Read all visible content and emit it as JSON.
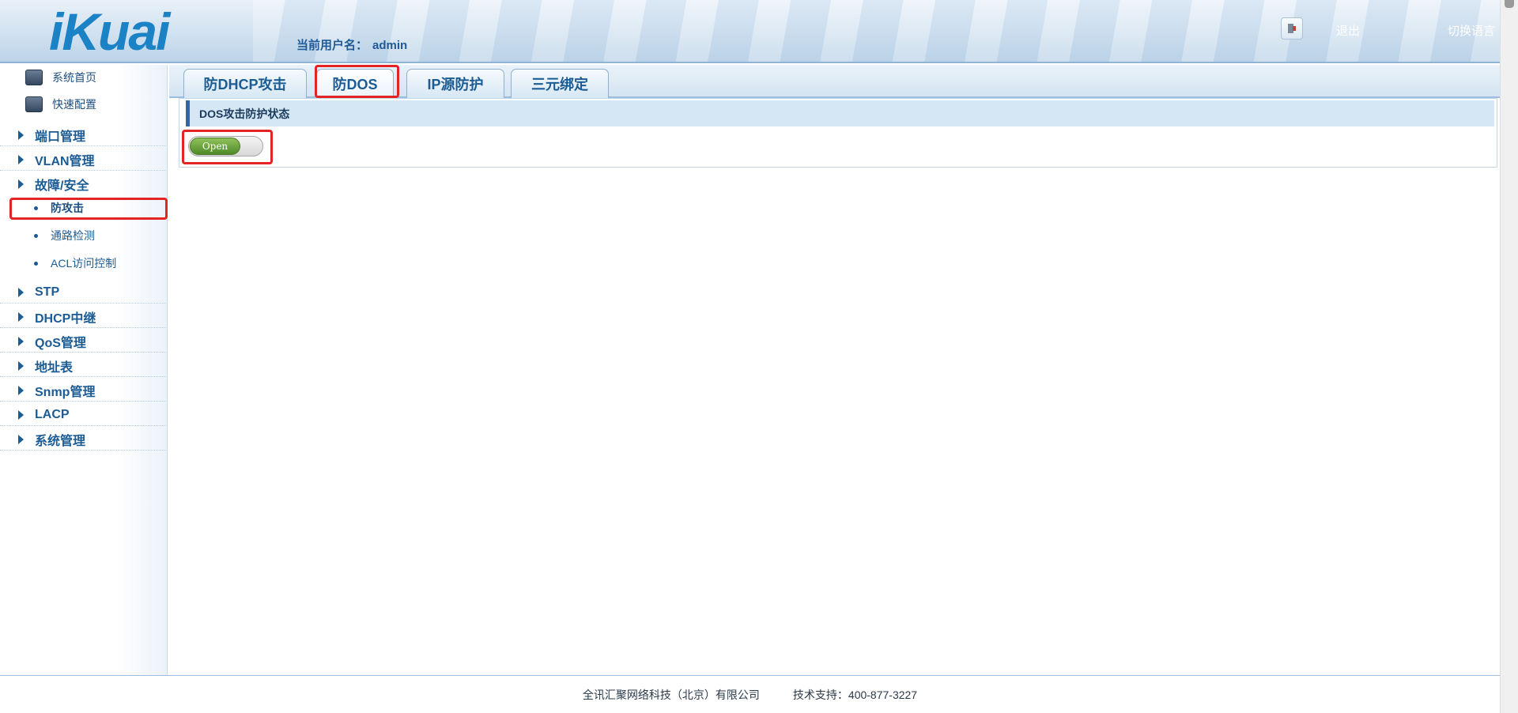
{
  "header": {
    "logo_text": "iKuai",
    "user_label": "当前用户名：",
    "user_name": "admin",
    "logout_label": "退出",
    "switch_language_label": "切换语言"
  },
  "sidebar": {
    "top_items": [
      {
        "label": "系统首页",
        "icon": "monitor-icon"
      },
      {
        "label": "快速配置",
        "icon": "config-icon"
      }
    ],
    "menu": [
      {
        "label": "端口管理"
      },
      {
        "label": "VLAN管理"
      },
      {
        "label": "故障/安全"
      },
      {
        "label": "STP"
      },
      {
        "label": "DHCP中继"
      },
      {
        "label": "QoS管理"
      },
      {
        "label": "地址表"
      },
      {
        "label": "Snmp管理"
      },
      {
        "label": "LACP"
      },
      {
        "label": "系统管理"
      }
    ],
    "sub_items": [
      {
        "label": "防攻击",
        "active": true
      },
      {
        "label": "通路检测"
      },
      {
        "label": "ACL访问控制"
      }
    ]
  },
  "tabs": [
    {
      "label": "防DHCP攻击"
    },
    {
      "label": "防DOS",
      "active": true
    },
    {
      "label": "IP源防护"
    },
    {
      "label": "三元绑定"
    }
  ],
  "panel": {
    "title": "DOS攻击防护状态",
    "toggle_label": "Open",
    "toggle_state": "on",
    "toggle_color": "#5a9a2e"
  },
  "footer": {
    "company": "全讯汇聚网络科技（北京）有限公司",
    "support": "技术支持：400-877-3227"
  },
  "colors": {
    "accent": "#1c82c6",
    "nav_text": "#1c5c94",
    "highlight": "#e32424"
  }
}
